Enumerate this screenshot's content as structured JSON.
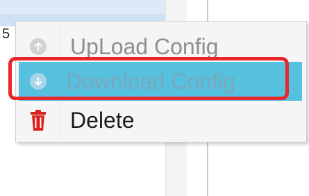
{
  "background": {
    "cell_text": "5"
  },
  "context_menu": {
    "items": [
      {
        "label": "UpLoad Config",
        "icon": "upload-arrow-icon",
        "state": "disabled"
      },
      {
        "label": "Download Config",
        "icon": "download-arrow-icon",
        "state": "highlighted"
      },
      {
        "label": "Delete",
        "icon": "trash-icon",
        "state": "normal"
      }
    ]
  },
  "colors": {
    "highlight": "#56c1df",
    "annotation": "#e8262b",
    "delete_icon": "#d9231f",
    "disabled_text": "#8f8f8f"
  }
}
